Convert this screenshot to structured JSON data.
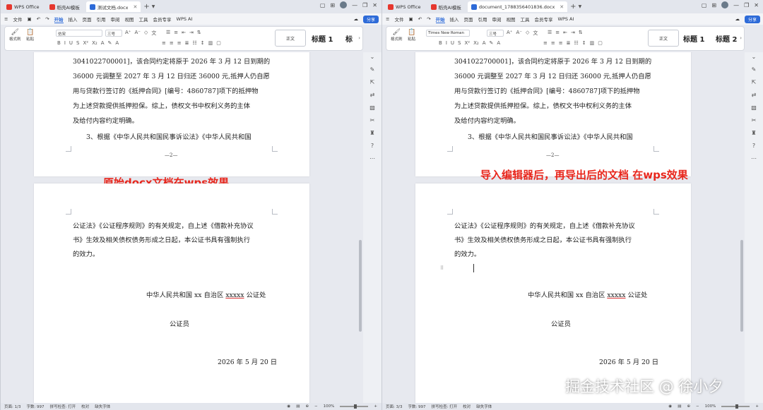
{
  "windows": [
    {
      "tabs": [
        {
          "label": "WPS Office"
        },
        {
          "label": "稻壳AI模板"
        },
        {
          "label": "测试文档.docx"
        }
      ],
      "menu": {
        "file": "文件",
        "items": [
          "开始",
          "插入",
          "页面",
          "引用",
          "审阅",
          "视图",
          "工具",
          "会员专享"
        ],
        "ai": "WPS AI",
        "share": "分享"
      },
      "ribbon": {
        "paste_label": "粘贴",
        "format_painter": "格式刷",
        "font_name": "仿宋",
        "font_size": "三号",
        "style_normal": "正文",
        "style_h1": "标题 1",
        "style_h2": "标"
      },
      "page1_lines": [
        "3041022700001]，该合同约定将原于 2026 年 3 月 12 日到期的",
        "36000 元调整至 2027 年 3 月 12 日归还 36000 元,抵押人仍自愿",
        "用与贷款行签订的《抵押合同》[编号：4860787]项下的抵押物",
        "为上述贷款提供抵押担保。综上，债权文书中权利义务的主体",
        "及给付内容约定明确。"
      ],
      "page1_last": "3、根据《中华人民共和国民事诉讼法》《中华人民共和国",
      "page_number": "—2—",
      "caption": "原始docx文档在wps效果",
      "page2_lines": [
        "公证法》《公证程序规则》的有关规定，自上述《借款补充协议",
        "书》生效及相关债权债务形成之日起，本公证书具有强制执行",
        "的效力。"
      ],
      "signer_prefix": "中华人民共和国 xx 自治区 ",
      "signer_mid": "xxxxx",
      "signer_suffix": " 公证处",
      "notary": "公证员",
      "date": "2026 年 5 月 20 日",
      "status": {
        "page": "页面: 1/3",
        "words": "字数: 997",
        "spell": "拼写检查: 打开",
        "proof": "校对",
        "font_missing": "缺失字体",
        "zoom": "100%"
      }
    },
    {
      "tabs": [
        {
          "label": "WPS Office"
        },
        {
          "label": "稻壳AI模板"
        },
        {
          "label": "document_1788356401836.docx"
        }
      ],
      "menu": {
        "file": "文件",
        "items": [
          "开始",
          "插入",
          "页面",
          "引用",
          "审阅",
          "视图",
          "工具",
          "会员专享"
        ],
        "ai": "WPS AI",
        "share": "分享"
      },
      "ribbon": {
        "paste_label": "粘贴",
        "format_painter": "格式刷",
        "font_name": "Times New Roman",
        "font_size": "三号",
        "style_normal": "正文",
        "style_h1": "标题 1",
        "style_h2": "标题 2"
      },
      "page1_lines": [
        "3041022700001]，该合同约定将原于 2026 年 3 月 12 日到期的",
        "36000 元调整至 2027 年 3 月 12 日归还 36000 元,抵押人仍自愿",
        "用与贷款行签订的《抵押合同》[编号：4860787]项下的抵押物",
        "为上述贷款提供抵押担保。综上，债权文书中权利义务的主体",
        "及给付内容约定明确。"
      ],
      "page1_last": "3、根据《中华人民共和国民事诉讼法》《中华人民共和国",
      "page_number": "—2—",
      "caption": "导入编辑器后，再导出后的文档 在wps效果",
      "page2_lines": [
        "公证法》《公证程序规则》的有关规定，自上述《借款补充协议",
        "书》生效及相关债权债务形成之日起，本公证书具有强制执行",
        "的效力。"
      ],
      "signer_prefix": "中华人民共和国 xx 自治区 ",
      "signer_mid": "xxxxx",
      "signer_suffix": " 公证处",
      "notary": "公证员",
      "date": "2026 年 5 月 20 日",
      "status": {
        "page": "页面: 3/3",
        "words": "字数: 997",
        "spell": "拼写检查: 打开",
        "proof": "校对",
        "font_missing": "缺失字体",
        "zoom": "100%"
      }
    }
  ],
  "watermark": "掘金技术社区 @ 徐小夕",
  "colors": {
    "caption": "#e8271d",
    "accent": "#2e6bd8"
  }
}
